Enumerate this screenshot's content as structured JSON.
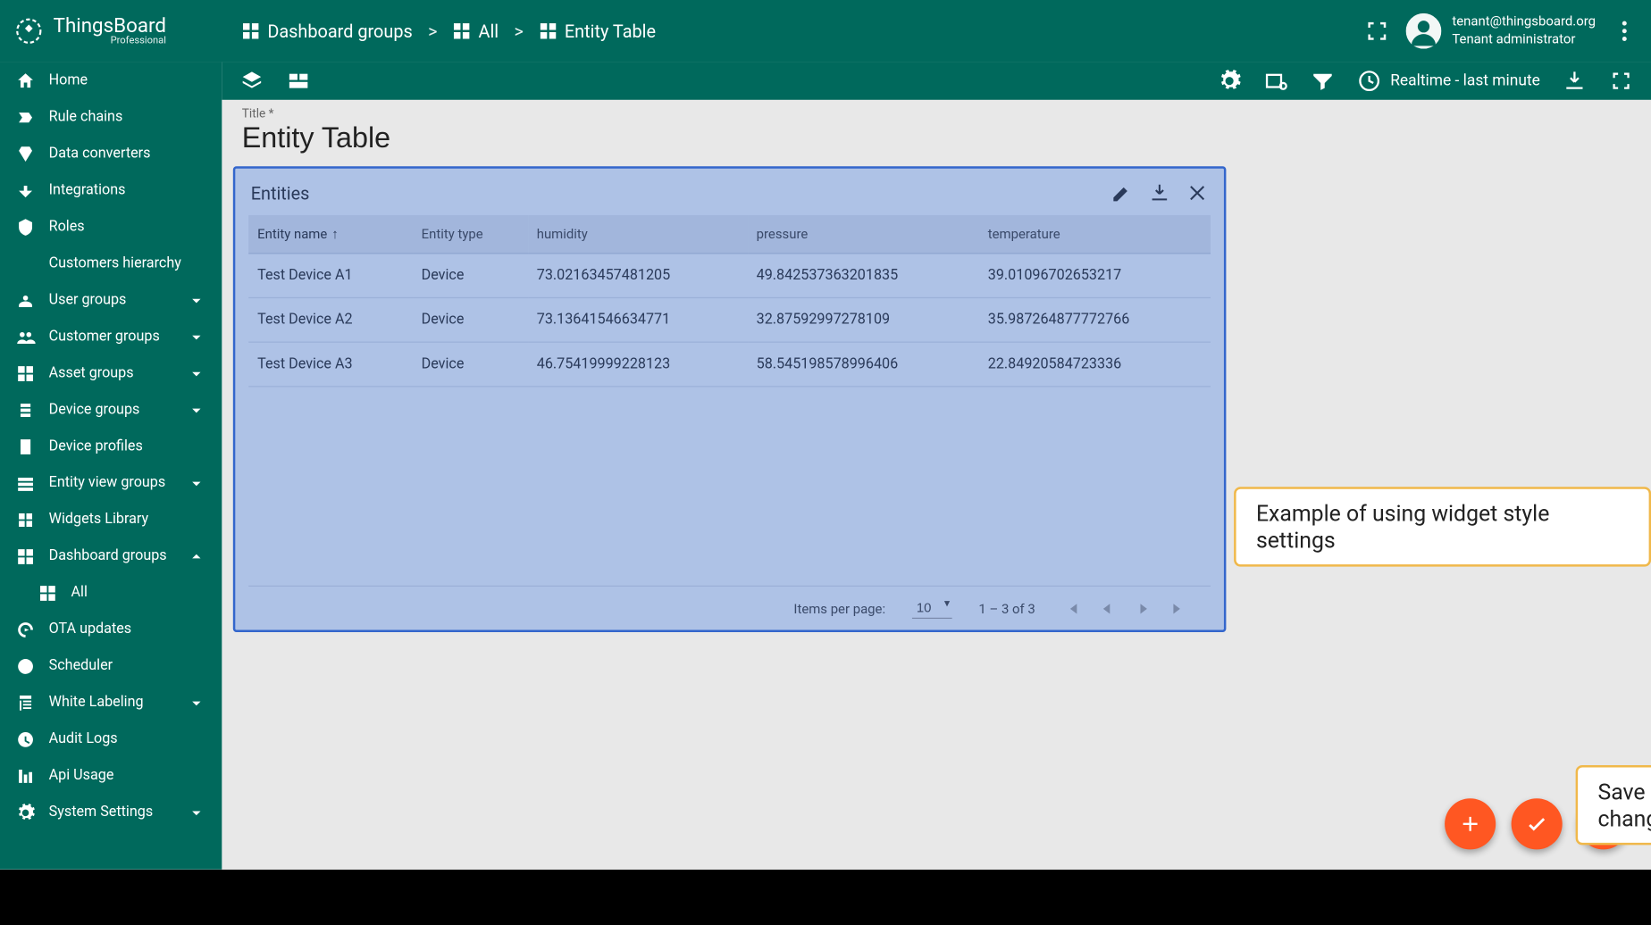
{
  "brand": {
    "name": "ThingsBoard",
    "edition": "Professional"
  },
  "breadcrumb": {
    "root": "Dashboard groups",
    "group": "All",
    "current": "Entity Table"
  },
  "user": {
    "email": "tenant@thingsboard.org",
    "role": "Tenant administrator"
  },
  "sidebar": {
    "items": [
      {
        "label": "Home"
      },
      {
        "label": "Rule chains"
      },
      {
        "label": "Data converters"
      },
      {
        "label": "Integrations"
      },
      {
        "label": "Roles"
      },
      {
        "label": "Customers hierarchy"
      },
      {
        "label": "User groups",
        "expandable": true
      },
      {
        "label": "Customer groups",
        "expandable": true
      },
      {
        "label": "Asset groups",
        "expandable": true
      },
      {
        "label": "Device groups",
        "expandable": true
      },
      {
        "label": "Device profiles"
      },
      {
        "label": "Entity view groups",
        "expandable": true
      },
      {
        "label": "Widgets Library"
      },
      {
        "label": "Dashboard groups",
        "expandable": true,
        "expanded": true
      },
      {
        "label": "All",
        "sub": true
      },
      {
        "label": "OTA updates"
      },
      {
        "label": "Scheduler"
      },
      {
        "label": "White Labeling",
        "expandable": true
      },
      {
        "label": "Audit Logs"
      },
      {
        "label": "Api Usage"
      },
      {
        "label": "System Settings",
        "expandable": true
      }
    ]
  },
  "toolbar": {
    "time_label": "Realtime - last minute"
  },
  "title_field": {
    "label": "Title *",
    "value": "Entity Table"
  },
  "widget": {
    "title": "Entities",
    "columns": [
      "Entity name",
      "Entity type",
      "humidity",
      "pressure",
      "temperature"
    ],
    "rows": [
      {
        "name": "Test Device A1",
        "type": "Device",
        "humidity": "73.02163457481205",
        "pressure": "49.842537363201835",
        "temperature": "39.01096702653217"
      },
      {
        "name": "Test Device A2",
        "type": "Device",
        "humidity": "73.13641546634771",
        "pressure": "32.87592997278109",
        "temperature": "35.987264877772766"
      },
      {
        "name": "Test Device A3",
        "type": "Device",
        "humidity": "46.75419999228123",
        "pressure": "58.545198578996406",
        "temperature": "22.84920584723336"
      }
    ],
    "pager": {
      "label": "Items per page:",
      "size": "10",
      "range": "1 – 3 of 3"
    }
  },
  "callouts": {
    "style_example": "Example of using widget style settings",
    "save": "Save changes"
  }
}
